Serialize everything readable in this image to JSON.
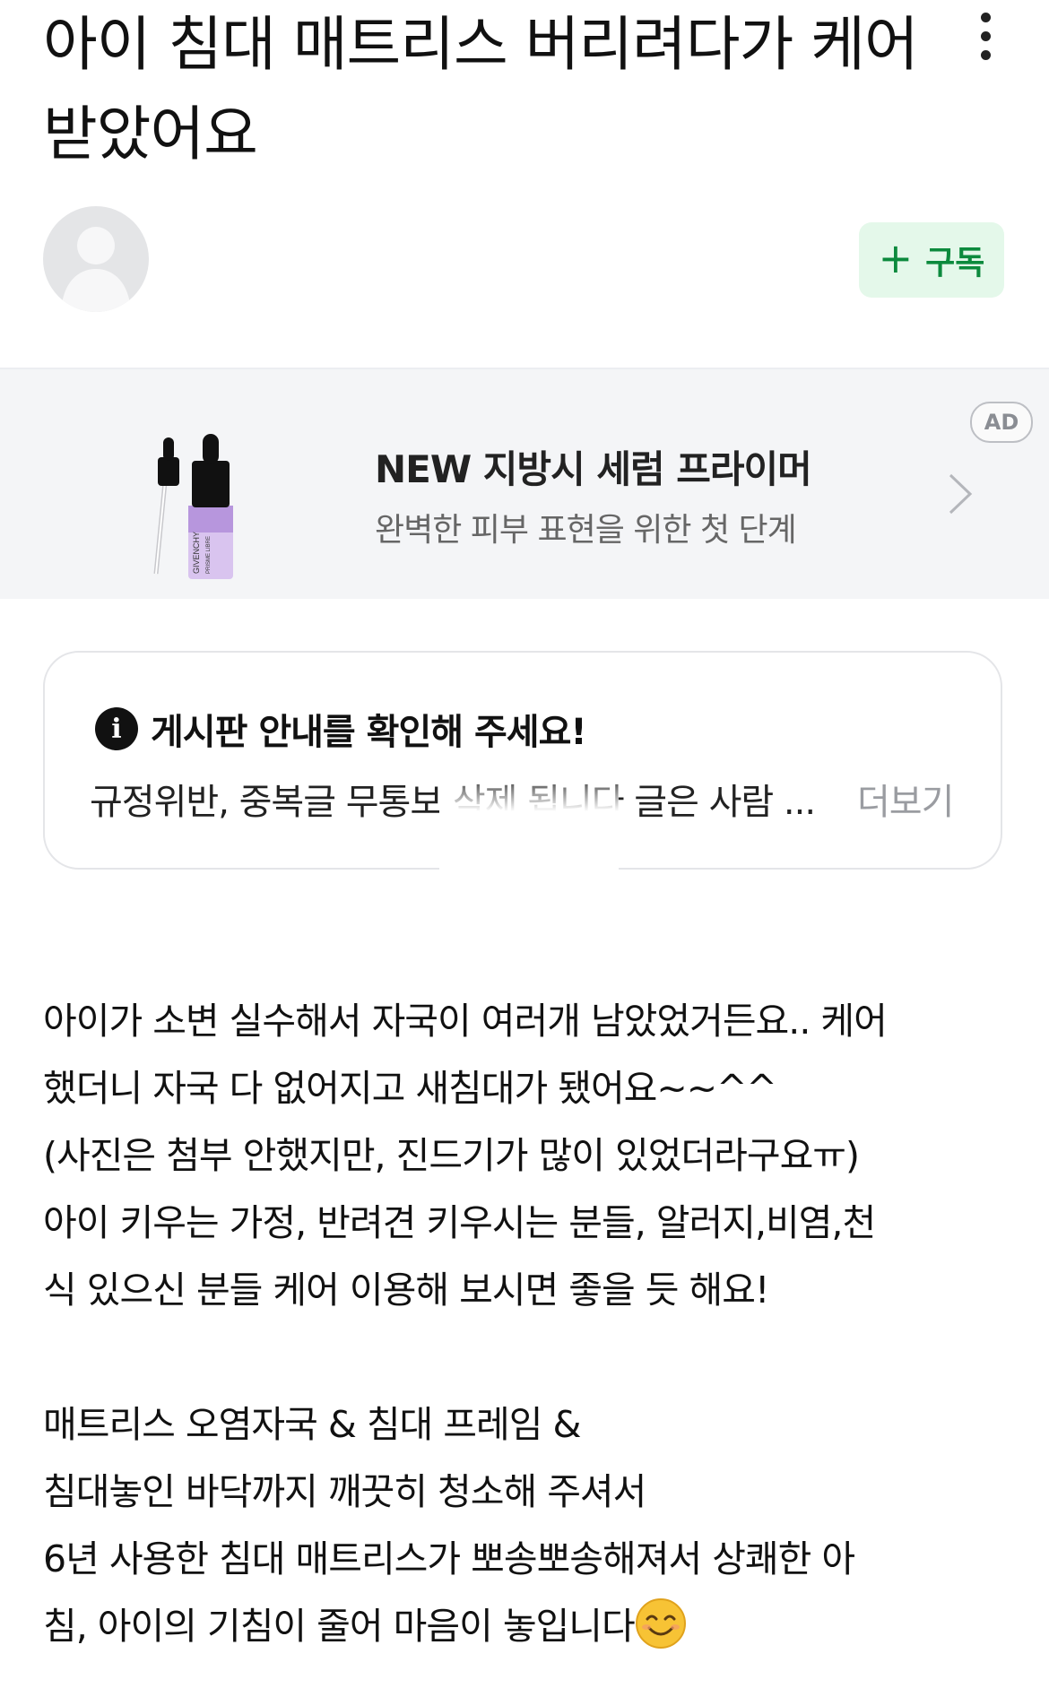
{
  "post": {
    "title_line1": "아이 침대 매트리스 버리려다가 케어",
    "title_line2": "받았어요"
  },
  "author": {
    "subscribe_label": "구독"
  },
  "ad": {
    "title": "NEW 지방시 세럼 프라이머",
    "description": "완벽한 피부 표현을 위한 첫 단계",
    "badge": "AD",
    "product_brand": "GIVENCHY",
    "product_name": "PRISME LIBRE"
  },
  "notice": {
    "title": "게시판 안내를 확인해 주세요!",
    "preview": "규정위반, 중복글 무통보 삭제 됩니다 글은 사람 ...",
    "more_label": "더보기"
  },
  "content": {
    "paragraph1": [
      "아이가 소변 실수해서 자국이 여러개 남았었거든요.. 케어",
      "했더니 자국 다 없어지고 새침대가 됐어요~~^^",
      "(사진은 첨부 안했지만, 진드기가 많이 있었더라구요ㅠ)",
      "아이 키우는 가정, 반려견 키우시는 분들, 알러지,비염,천",
      "식 있으신 분들 케어 이용해 보시면 좋을 듯 해요!"
    ],
    "paragraph2": [
      "매트리스 오염자국 & 침대 프레임 &",
      "침대놓인 바닥까지 깨끗히 청소해 주셔서",
      "6년 사용한 침대 매트리스가 뽀송뽀송해져서 상쾌한 아",
      "침, 아이의 기침이 줄어 마음이 놓입니다"
    ]
  }
}
